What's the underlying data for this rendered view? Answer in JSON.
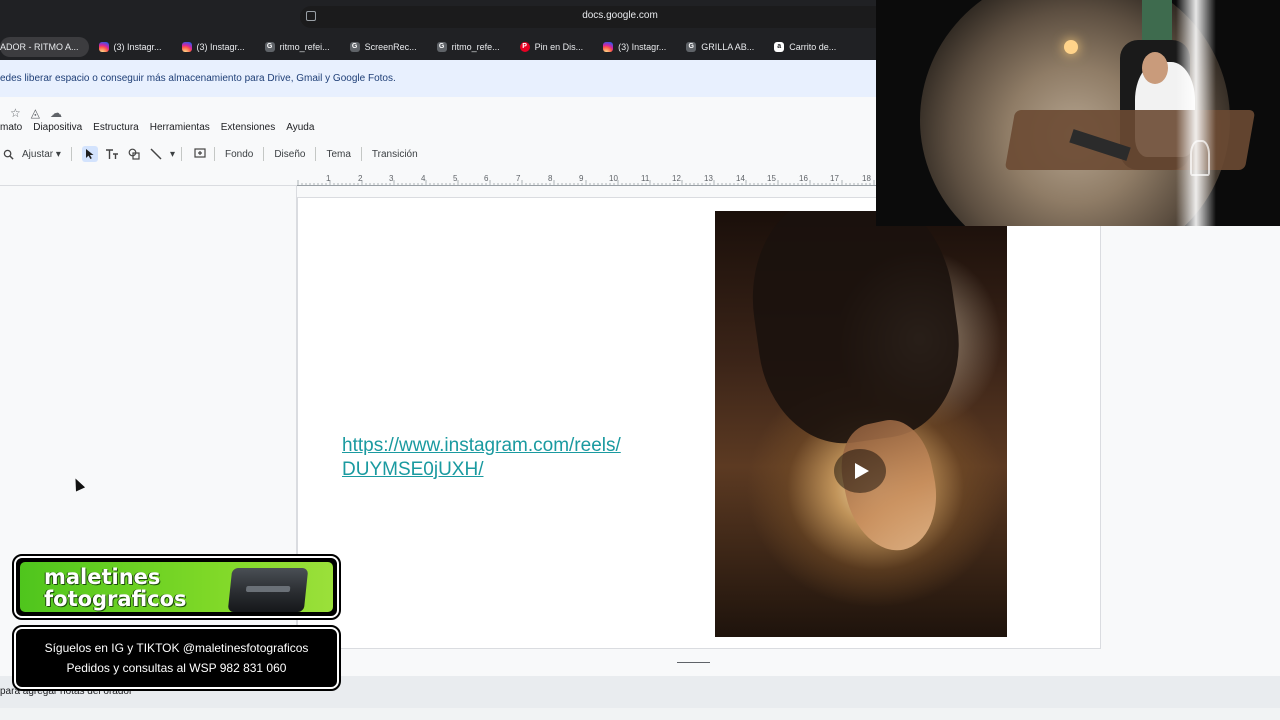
{
  "browser": {
    "url": "docs.google.com",
    "tabs": [
      {
        "label": "ADOR - RITMO A...",
        "icon": "none",
        "active": true
      },
      {
        "label": "(3) Instagr...",
        "icon": "instagram-icon"
      },
      {
        "label": "(3) Instagr...",
        "icon": "instagram-icon"
      },
      {
        "label": "ritmo_refei...",
        "icon": "google-icon"
      },
      {
        "label": "ScreenRec...",
        "icon": "google-icon"
      },
      {
        "label": "ritmo_refe...",
        "icon": "google-icon"
      },
      {
        "label": "Pin en Dis...",
        "icon": "pinterest-icon"
      },
      {
        "label": "(3) Instagr...",
        "icon": "instagram-icon"
      },
      {
        "label": "GRILLA AB...",
        "icon": "google-icon"
      },
      {
        "label": "Carrito de...",
        "icon": "amazon-icon"
      }
    ]
  },
  "banner": {
    "text": "edes liberar espacio o conseguir más almacenamiento para Drive, Gmail y Google Fotos."
  },
  "menu": {
    "items": [
      "mato",
      "Diapositiva",
      "Estructura",
      "Herramientas",
      "Extensiones",
      "Ayuda"
    ]
  },
  "toolbar": {
    "zoom_label": "Ajustar",
    "fondo": "Fondo",
    "diseno": "Diseño",
    "tema": "Tema",
    "transicion": "Transición"
  },
  "ruler": {
    "ticks": [
      "1",
      "2",
      "3",
      "4",
      "5",
      "6",
      "7",
      "8",
      "9",
      "10",
      "11",
      "12",
      "13",
      "14",
      "15",
      "16",
      "17",
      "18"
    ]
  },
  "slide": {
    "link_text": "https://www.instagram.com/reels/DUYMSE0jUXH/"
  },
  "notes": {
    "placeholder": "para agregar notas del orador"
  },
  "overlay": {
    "brand_line1": "maletines",
    "brand_line2": "fotograficos",
    "info_line1": "Síguelos en IG y TIKTOK @maletinesfotograficos",
    "info_line2": "Pedidos y consultas al WSP 982 831 060"
  },
  "colors": {
    "link": "#1a9aa0",
    "banner_bg": "#e8f0fe",
    "brand_green": "#6fd12a"
  }
}
